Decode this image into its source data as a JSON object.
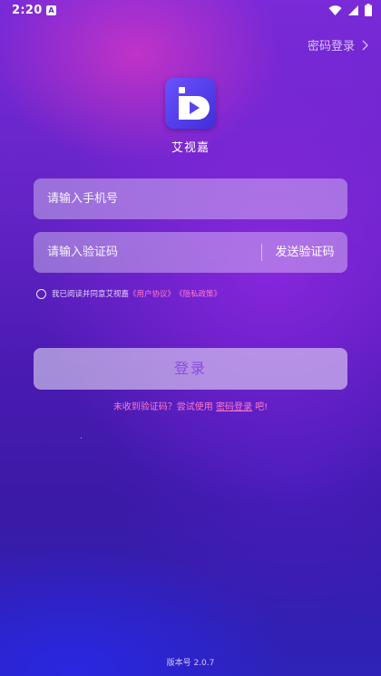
{
  "status_bar": {
    "time": "2:20",
    "notif_letter": "A",
    "icons": [
      "wifi-icon",
      "signal-icon",
      "battery-icon"
    ]
  },
  "header": {
    "password_login_label": "密码登录"
  },
  "app": {
    "name": "艾视嘉"
  },
  "form": {
    "phone_placeholder": "请输入手机号",
    "code_placeholder": "请输入验证码",
    "send_code_label": "发送验证码",
    "agreement": {
      "prefix": "我已阅读并同意艾视嘉",
      "user_agreement": "《用户协议》",
      "privacy_policy": "《隐私政策》"
    },
    "login_label": "登录",
    "hint_prefix": "未收到验证码？尝试使用 ",
    "hint_link": "密码登录",
    "hint_suffix": " 吧!"
  },
  "footer": {
    "version": "版本号 2.0.7"
  },
  "colors": {
    "accent_pink": "#ff7ac8",
    "button_text": "#8a4be0",
    "logo_blue": "#5a44f0"
  }
}
